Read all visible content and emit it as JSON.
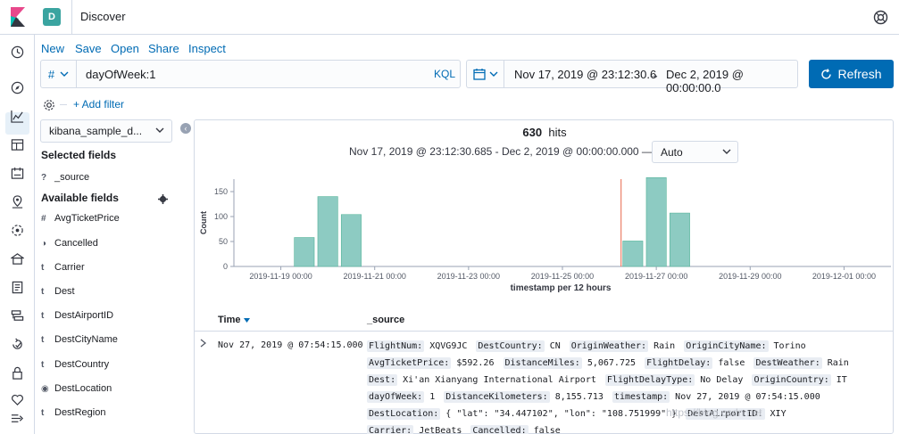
{
  "header": {
    "space_initial": "D",
    "title": "Discover"
  },
  "menu": {
    "new": "New",
    "save": "Save",
    "open": "Open",
    "share": "Share",
    "inspect": "Inspect"
  },
  "query": {
    "lang_symbol": "#",
    "value": "dayOfWeek:1",
    "language": "KQL"
  },
  "time": {
    "start": "Nov 17, 2019 @ 23:12:30.6",
    "arrow": "→",
    "end": "Dec 2, 2019 @ 00:00:00.0",
    "refresh_label": "Refresh"
  },
  "filters": {
    "add_filter": "+ Add filter"
  },
  "sidebar": {
    "index_pattern": "kibana_sample_d...",
    "selected_title": "Selected fields",
    "selected_fields": [
      {
        "type": "?",
        "name": "_source"
      }
    ],
    "available_title": "Available fields",
    "available_fields": [
      {
        "type": "#",
        "name": "AvgTicketPrice"
      },
      {
        "type": "◑",
        "name": "Cancelled"
      },
      {
        "type": "t",
        "name": "Carrier"
      },
      {
        "type": "t",
        "name": "Dest"
      },
      {
        "type": "t",
        "name": "DestAirportID"
      },
      {
        "type": "t",
        "name": "DestCityName"
      },
      {
        "type": "t",
        "name": "DestCountry"
      },
      {
        "type": "◉",
        "name": "DestLocation"
      },
      {
        "type": "t",
        "name": "DestRegion"
      }
    ]
  },
  "results": {
    "hit_count": "630",
    "hits_label": "hits",
    "range_text": "Nov 17, 2019 @ 23:12:30.685 - Dec 2, 2019 @ 00:00:00.000 —",
    "interval": "Auto"
  },
  "chart_data": {
    "type": "bar",
    "xlabel": "timestamp per 12 hours",
    "ylabel": "Count",
    "ylim": [
      0,
      175
    ],
    "yticks": [
      0,
      50,
      100,
      150
    ],
    "xlim": [
      "2019-11-18T00:00",
      "2019-12-02T00:00"
    ],
    "xticks": [
      "2019-11-19 00:00",
      "2019-11-21 00:00",
      "2019-11-23 00:00",
      "2019-11-25 00:00",
      "2019-11-27 00:00",
      "2019-11-29 00:00",
      "2019-12-01 00:00"
    ],
    "bars": [
      {
        "x": "2019-11-19T12:00",
        "value": 58
      },
      {
        "x": "2019-11-20T00:00",
        "value": 140
      },
      {
        "x": "2019-11-20T12:00",
        "value": 104
      },
      {
        "x": "2019-11-26T12:00",
        "value": 51
      },
      {
        "x": "2019-11-27T00:00",
        "value": 178
      },
      {
        "x": "2019-11-27T12:00",
        "value": 107
      }
    ],
    "now_marker": "2019-11-26T06:00",
    "bar_color": "#8dcbc2",
    "bar_stroke": "#54b399",
    "marker_color": "#e7664c",
    "grid": false
  },
  "table": {
    "col_time": "Time",
    "col_source": "_source",
    "rows": [
      {
        "time": "Nov 27, 2019 @ 07:54:15.000",
        "source": [
          {
            "k": "FlightNum:",
            "v": "XQVG9JC"
          },
          {
            "k": "DestCountry:",
            "v": "CN"
          },
          {
            "k": "OriginWeather:",
            "v": "Rain"
          },
          {
            "k": "OriginCityName:",
            "v": "Torino"
          },
          {
            "k": "AvgTicketPrice:",
            "v": "$592.26"
          },
          {
            "k": "DistanceMiles:",
            "v": "5,067.725"
          },
          {
            "k": "FlightDelay:",
            "v": "false"
          },
          {
            "k": "DestWeather:",
            "v": "Rain"
          },
          {
            "k": "Dest:",
            "v": "Xi'an Xianyang International Airport"
          },
          {
            "k": "FlightDelayType:",
            "v": "No Delay"
          },
          {
            "k": "OriginCountry:",
            "v": "IT"
          },
          {
            "k": "dayOfWeek:",
            "v": "1"
          },
          {
            "k": "DistanceKilometers:",
            "v": "8,155.713"
          },
          {
            "k": "timestamp:",
            "v": "Nov 27, 2019 @ 07:54:15.000"
          },
          {
            "k": "DestLocation:",
            "v": "{ \"lat\": \"34.447102\", \"lon\": \"108.751999\" }"
          },
          {
            "k": "DestAirportID:",
            "v": "XIY"
          },
          {
            "k": "Carrier:",
            "v": "JetBeats"
          },
          {
            "k": "Cancelled:",
            "v": "false"
          }
        ]
      }
    ]
  },
  "watermark": "https://blog.csdn.net",
  "colors": {
    "link": "#006bb4",
    "accent": "#3aa4a0",
    "border": "#d3dae6"
  }
}
